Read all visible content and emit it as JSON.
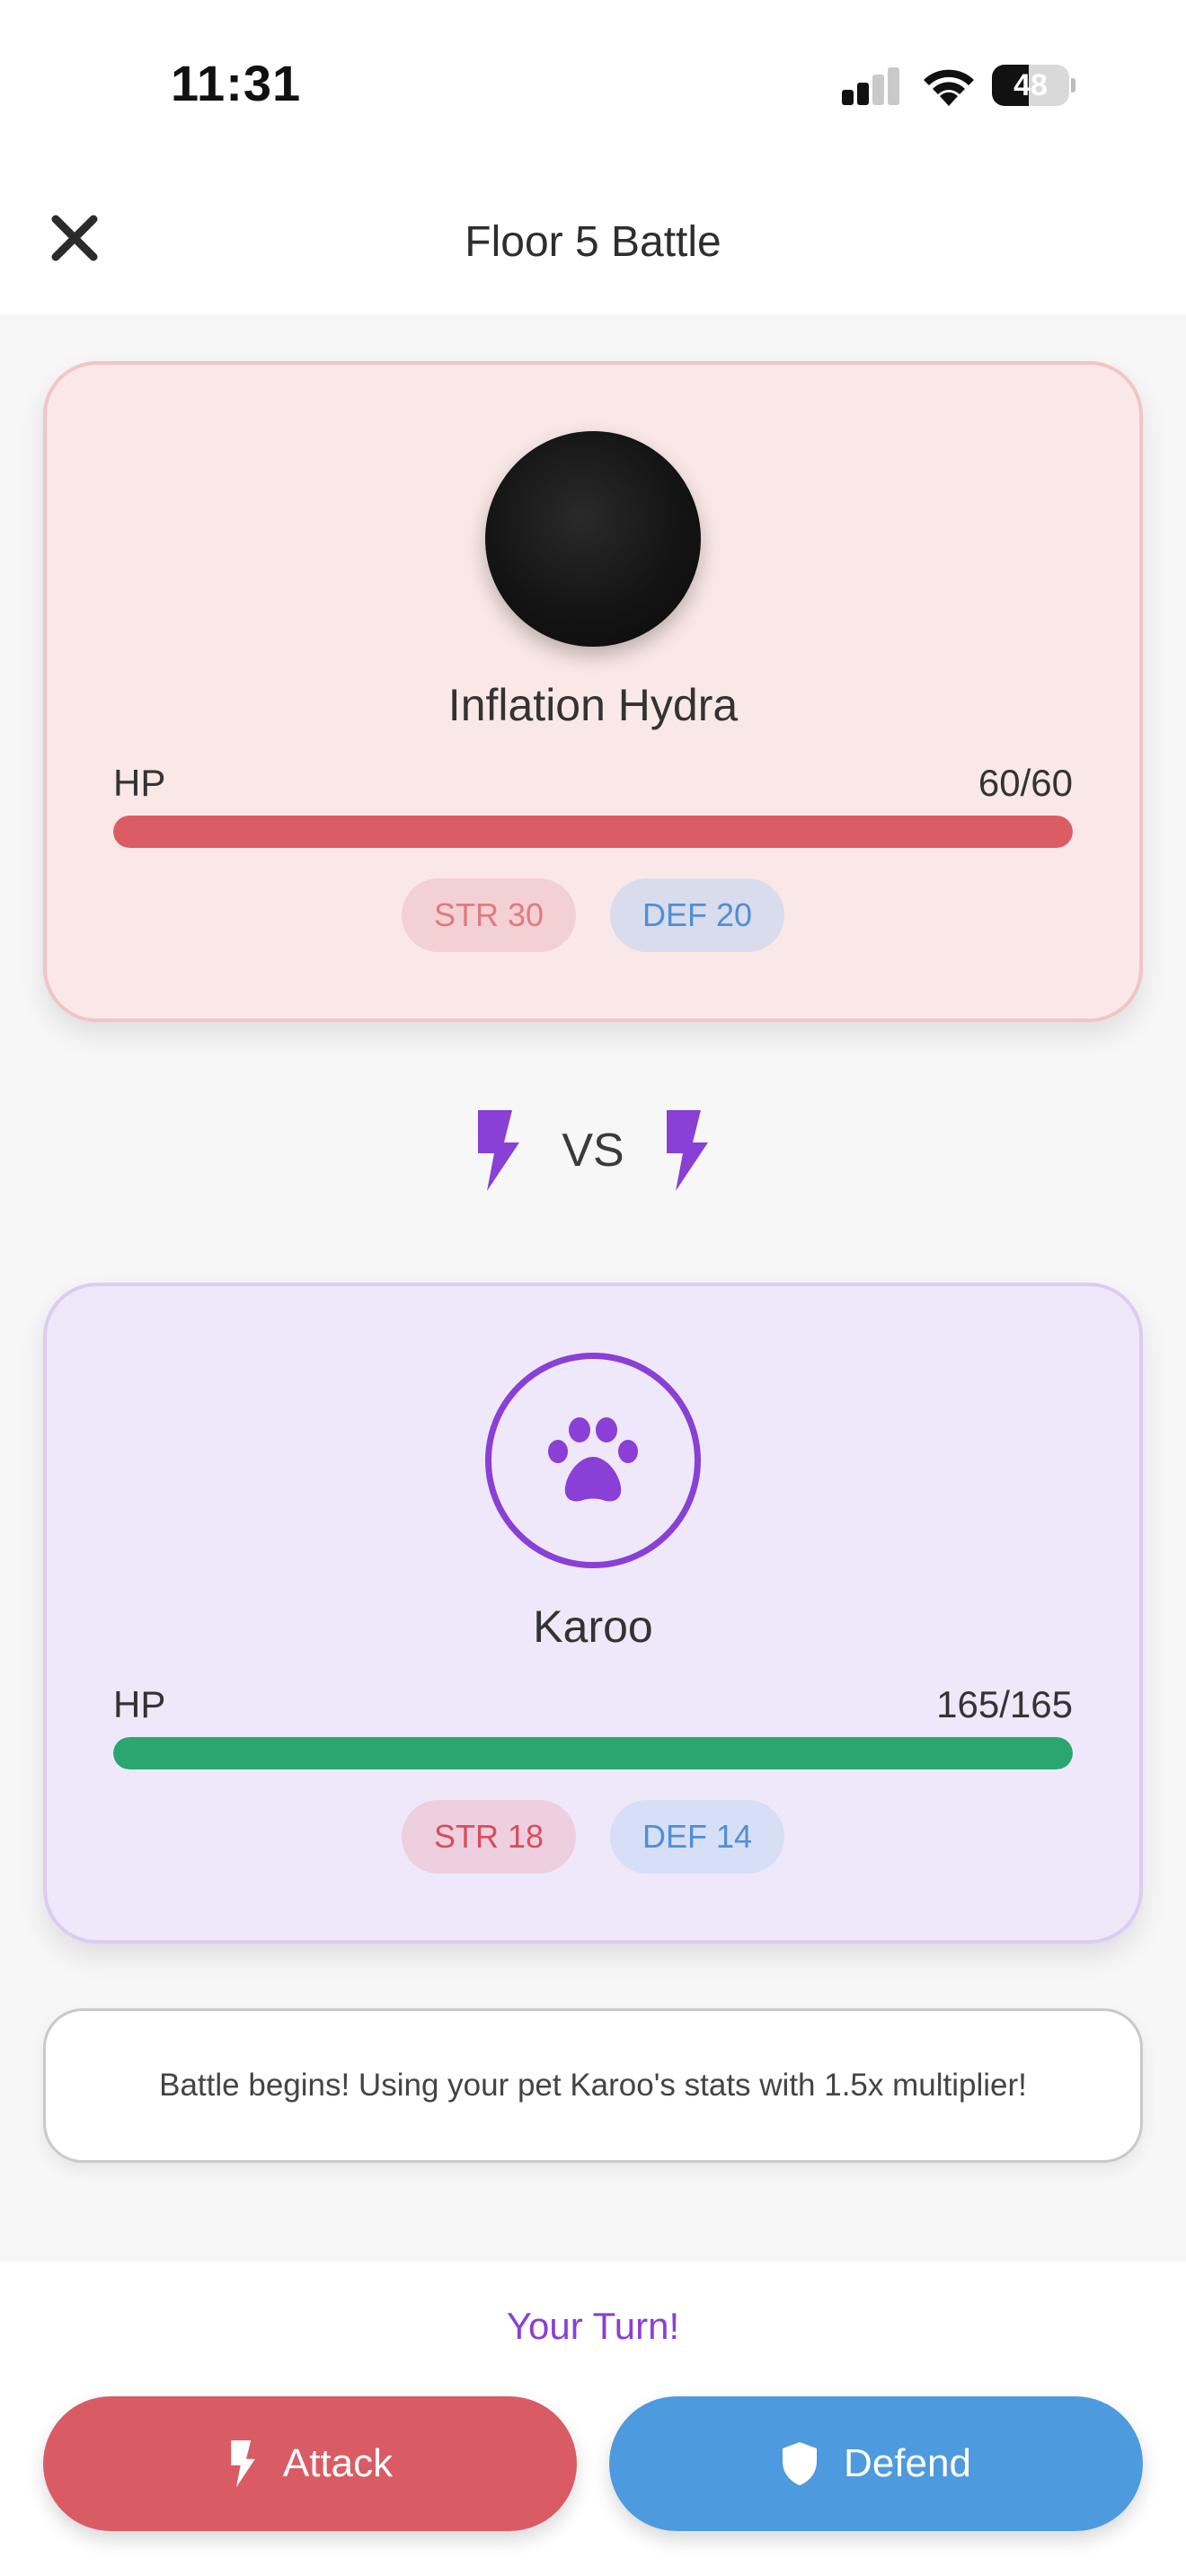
{
  "status_bar": {
    "time": "11:31",
    "battery_level": "48",
    "battery_fraction": 0.48,
    "icons": [
      "cellular-signal-icon",
      "wifi-icon",
      "battery-icon"
    ]
  },
  "header": {
    "title": "Floor 5 Battle",
    "close_icon": "close-icon"
  },
  "enemy": {
    "name": "Inflation Hydra",
    "hp_label": "HP",
    "hp_text": "60/60",
    "hp_fraction": 1.0,
    "str_label": "STR 30",
    "def_label": "DEF 20",
    "hp_color": "#dc5c64"
  },
  "vs": {
    "text": "VS",
    "icon": "lightning-bolt-icon",
    "color": "#8a3fd6"
  },
  "pet": {
    "name": "Karoo",
    "avatar_icon": "paw-icon",
    "hp_label": "HP",
    "hp_text": "165/165",
    "hp_fraction": 1.0,
    "str_label": "STR 18",
    "def_label": "DEF 14",
    "hp_color": "#2ba66f"
  },
  "battle_log": {
    "message": "Battle begins! Using your pet Karoo's stats with 1.5x multiplier!"
  },
  "actions": {
    "turn_text": "Your Turn!",
    "attack_label": "Attack",
    "attack_icon": "lightning-bolt-icon",
    "attack_color": "#d95c64",
    "defend_label": "Defend",
    "defend_icon": "shield-icon",
    "defend_color": "#4e9ade"
  }
}
